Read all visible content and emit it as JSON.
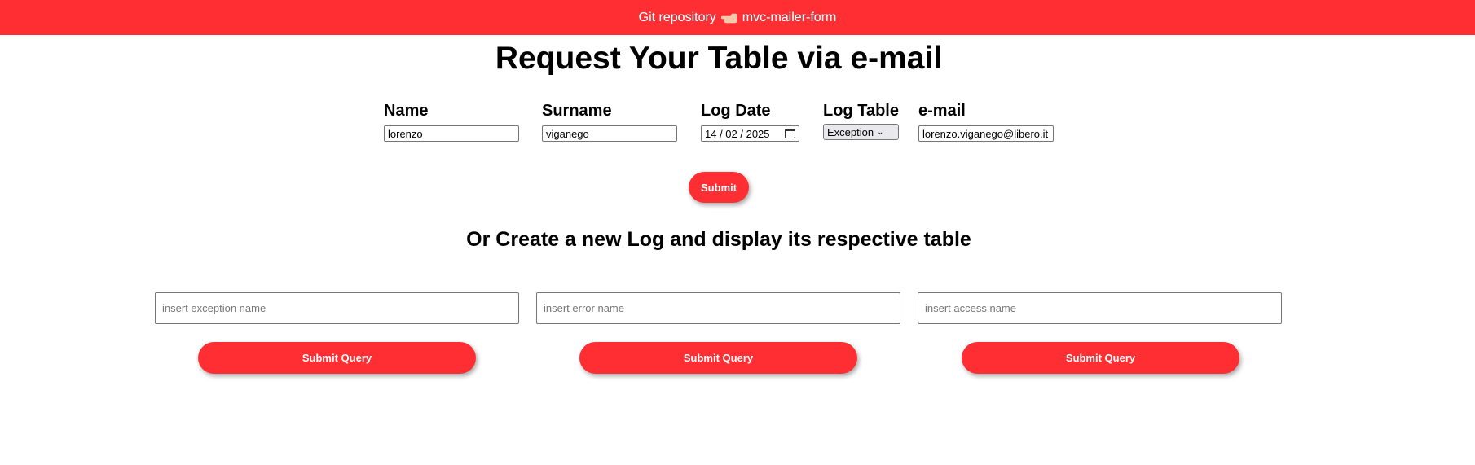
{
  "topbar": {
    "repo_label": "Git repository",
    "repo_name": "mvc-mailer-form",
    "icon": "pointing-hand-icon"
  },
  "request": {
    "title": "Request Your Table via e-mail",
    "name_label": "Name",
    "name_value": "lorenzo",
    "surname_label": "Surname",
    "surname_value": "viganego",
    "date_label": "Log Date",
    "date_value": "14 / 02 / 2025",
    "table_label": "Log Table",
    "table_value": "Exception",
    "email_label": "e-mail",
    "email_value": "lorenzo.viganego@libero.it",
    "submit_label": "Submit"
  },
  "create": {
    "title": "Or Create a new Log and display its respective table",
    "exception_placeholder": "insert exception name",
    "error_placeholder": "insert error name",
    "access_placeholder": "insert access name",
    "submit_label": "Submit Query"
  },
  "colors": {
    "accent": "#ff2e33"
  }
}
